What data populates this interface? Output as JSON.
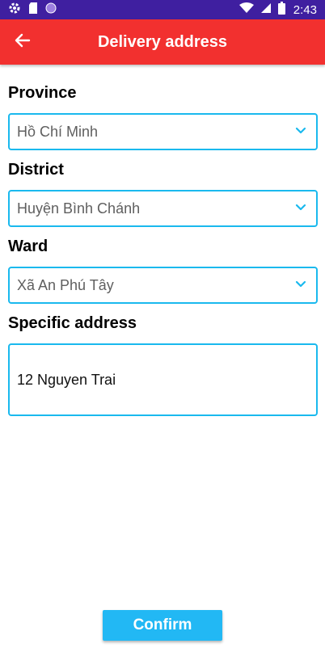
{
  "status_bar": {
    "time": "2:43",
    "left_icons": [
      "gear-icon",
      "sd-card-icon",
      "circle-icon"
    ],
    "right_icons": [
      "wifi-icon",
      "signal-icon",
      "battery-icon"
    ]
  },
  "app_bar": {
    "title": "Delivery address",
    "back_icon": "arrow-left-icon",
    "color": "#f2302f"
  },
  "form": {
    "province": {
      "label": "Province",
      "value": "Hồ Chí Minh"
    },
    "district": {
      "label": "District",
      "value": "Huyện Bình Chánh"
    },
    "ward": {
      "label": "Ward",
      "value": "Xã An Phú Tây"
    },
    "specific_address": {
      "label": "Specific address",
      "value": "12 Nguyen Trai"
    },
    "border_color": "#1ab9ee",
    "dropdown_icon": "chevron-down-icon"
  },
  "confirm": {
    "label": "Confirm",
    "color": "#22b8f4"
  }
}
